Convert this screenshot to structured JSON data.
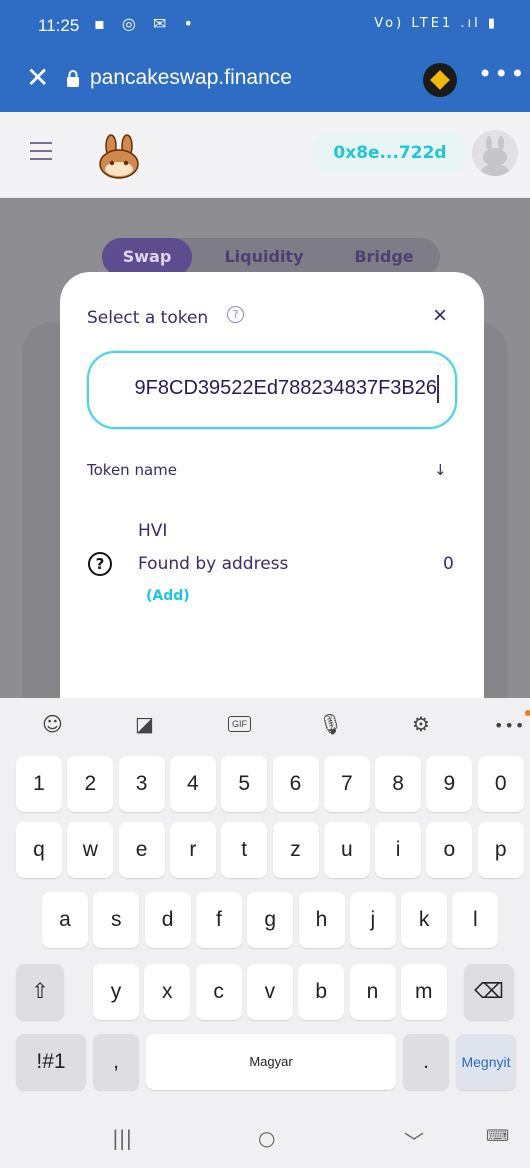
{
  "status": {
    "time": "11:25",
    "left_icons": "▪ ◎ ✉ •",
    "right_icons": "Vo) LTE1 .ıl ▮"
  },
  "browser": {
    "url": "pancakeswap.finance",
    "close_icon": "close-icon",
    "more_label": "•••"
  },
  "header": {
    "wallet_address": "0x8e...722d"
  },
  "tabs": [
    {
      "label": "Swap"
    },
    {
      "label": "Liquidity"
    },
    {
      "label": "Bridge"
    }
  ],
  "modal": {
    "title": "Select a token",
    "close_label": "×",
    "search_value": "9F8CD39522Ed788234837F3B26",
    "column_header": "Token name",
    "sort_icon": "↓",
    "token": {
      "symbol": "HVI",
      "name": "Found by address",
      "add_label": "(Add)",
      "balance": "0",
      "icon_glyph": "?"
    }
  },
  "keyboard": {
    "toolbar": {
      "emoji": "☺",
      "sticker": "◪",
      "gif": "GIF",
      "mic": "🎙",
      "settings": "⚙",
      "more": "•••"
    },
    "row_numbers": [
      "1",
      "2",
      "3",
      "4",
      "5",
      "6",
      "7",
      "8",
      "9",
      "0"
    ],
    "row_1": [
      "q",
      "w",
      "e",
      "r",
      "t",
      "z",
      "u",
      "i",
      "o",
      "p"
    ],
    "row_2": [
      "a",
      "s",
      "d",
      "f",
      "g",
      "h",
      "j",
      "k",
      "l"
    ],
    "row_3": [
      "y",
      "x",
      "c",
      "v",
      "b",
      "n",
      "m"
    ],
    "shift": "⇧",
    "backspace": "⌫",
    "symbols": "!#1",
    "comma": ",",
    "space_label": "Magyar",
    "period": ".",
    "enter_label": "Megnyit"
  },
  "navbar": {
    "recents": "|||",
    "home": "○",
    "back": "﹀",
    "keyboard": "⌨"
  },
  "colors": {
    "brand_blue": "#2e6dc3",
    "accent_cyan": "#1fc7d4",
    "text_purple": "#3d2b63"
  }
}
